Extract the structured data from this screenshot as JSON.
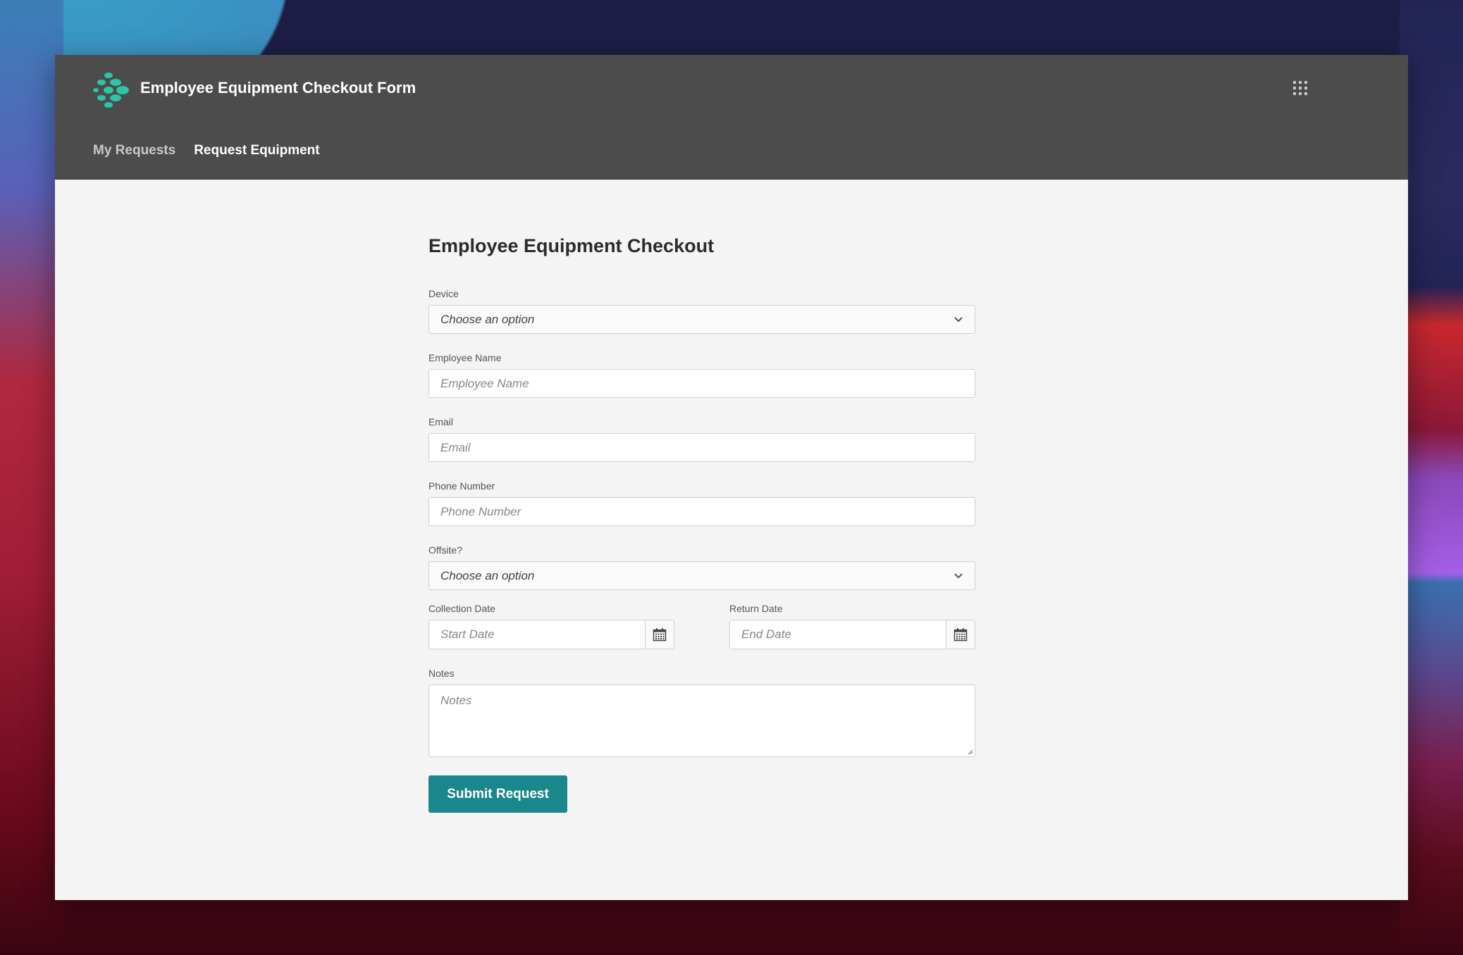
{
  "app": {
    "title": "Employee Equipment Checkout Form",
    "logo": "dots-diamond-logo",
    "apps_icon": "grid-apps-icon",
    "brand_color": "#2ec4a6"
  },
  "nav": {
    "items": [
      {
        "label": "My Requests",
        "active": false
      },
      {
        "label": "Request Equipment",
        "active": true
      }
    ]
  },
  "form": {
    "title": "Employee Equipment Checkout",
    "device": {
      "label": "Device",
      "value": "Choose an option"
    },
    "employee_name": {
      "label": "Employee Name",
      "placeholder": "Employee Name"
    },
    "email": {
      "label": "Email",
      "placeholder": "Email"
    },
    "phone": {
      "label": "Phone Number",
      "placeholder": "Phone Number"
    },
    "offsite": {
      "label": "Offsite?",
      "value": "Choose an option"
    },
    "collection_date": {
      "label": "Collection Date",
      "placeholder": "Start Date"
    },
    "return_date": {
      "label": "Return Date",
      "placeholder": "End Date"
    },
    "notes": {
      "label": "Notes",
      "placeholder": "Notes"
    },
    "submit_label": "Submit Request",
    "submit_color": "#1a878a"
  }
}
